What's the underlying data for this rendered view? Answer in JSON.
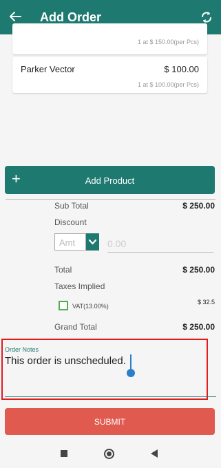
{
  "appbar": {
    "title": "Add Order",
    "back_icon": "arrow-left-icon",
    "sync_icon": "sync-icon"
  },
  "products": [
    {
      "name": "",
      "price": "",
      "detail": "1 at $ 150.00(per Pcs)"
    },
    {
      "name": "Parker Vector",
      "price": "$ 100.00",
      "detail": "1 at $ 100.00(per Pcs)"
    }
  ],
  "add_product": {
    "label": "Add Product",
    "icon": "+"
  },
  "summary": {
    "subtotal_label": "Sub Total",
    "subtotal_value": "$ 250.00",
    "discount_label": "Discount",
    "discount_type_placeholder": "Amt",
    "discount_value_placeholder": "0.00",
    "total_label": "Total",
    "total_value": "$ 250.00",
    "taxes_label": "Taxes Implied",
    "vat_label": "VAT(13.00%)",
    "vat_value": "$ 32.5",
    "grand_total_label": "Grand Total",
    "grand_total_value": "$ 250.00"
  },
  "notes": {
    "label": "Order Notes",
    "value": "This order is unscheduled."
  },
  "submit": {
    "label": "SUBMIT"
  },
  "colors": {
    "primary": "#1e7a70",
    "submit": "#e05a4f",
    "highlight": "#e01c1c",
    "cursor": "#2a7fc9"
  }
}
